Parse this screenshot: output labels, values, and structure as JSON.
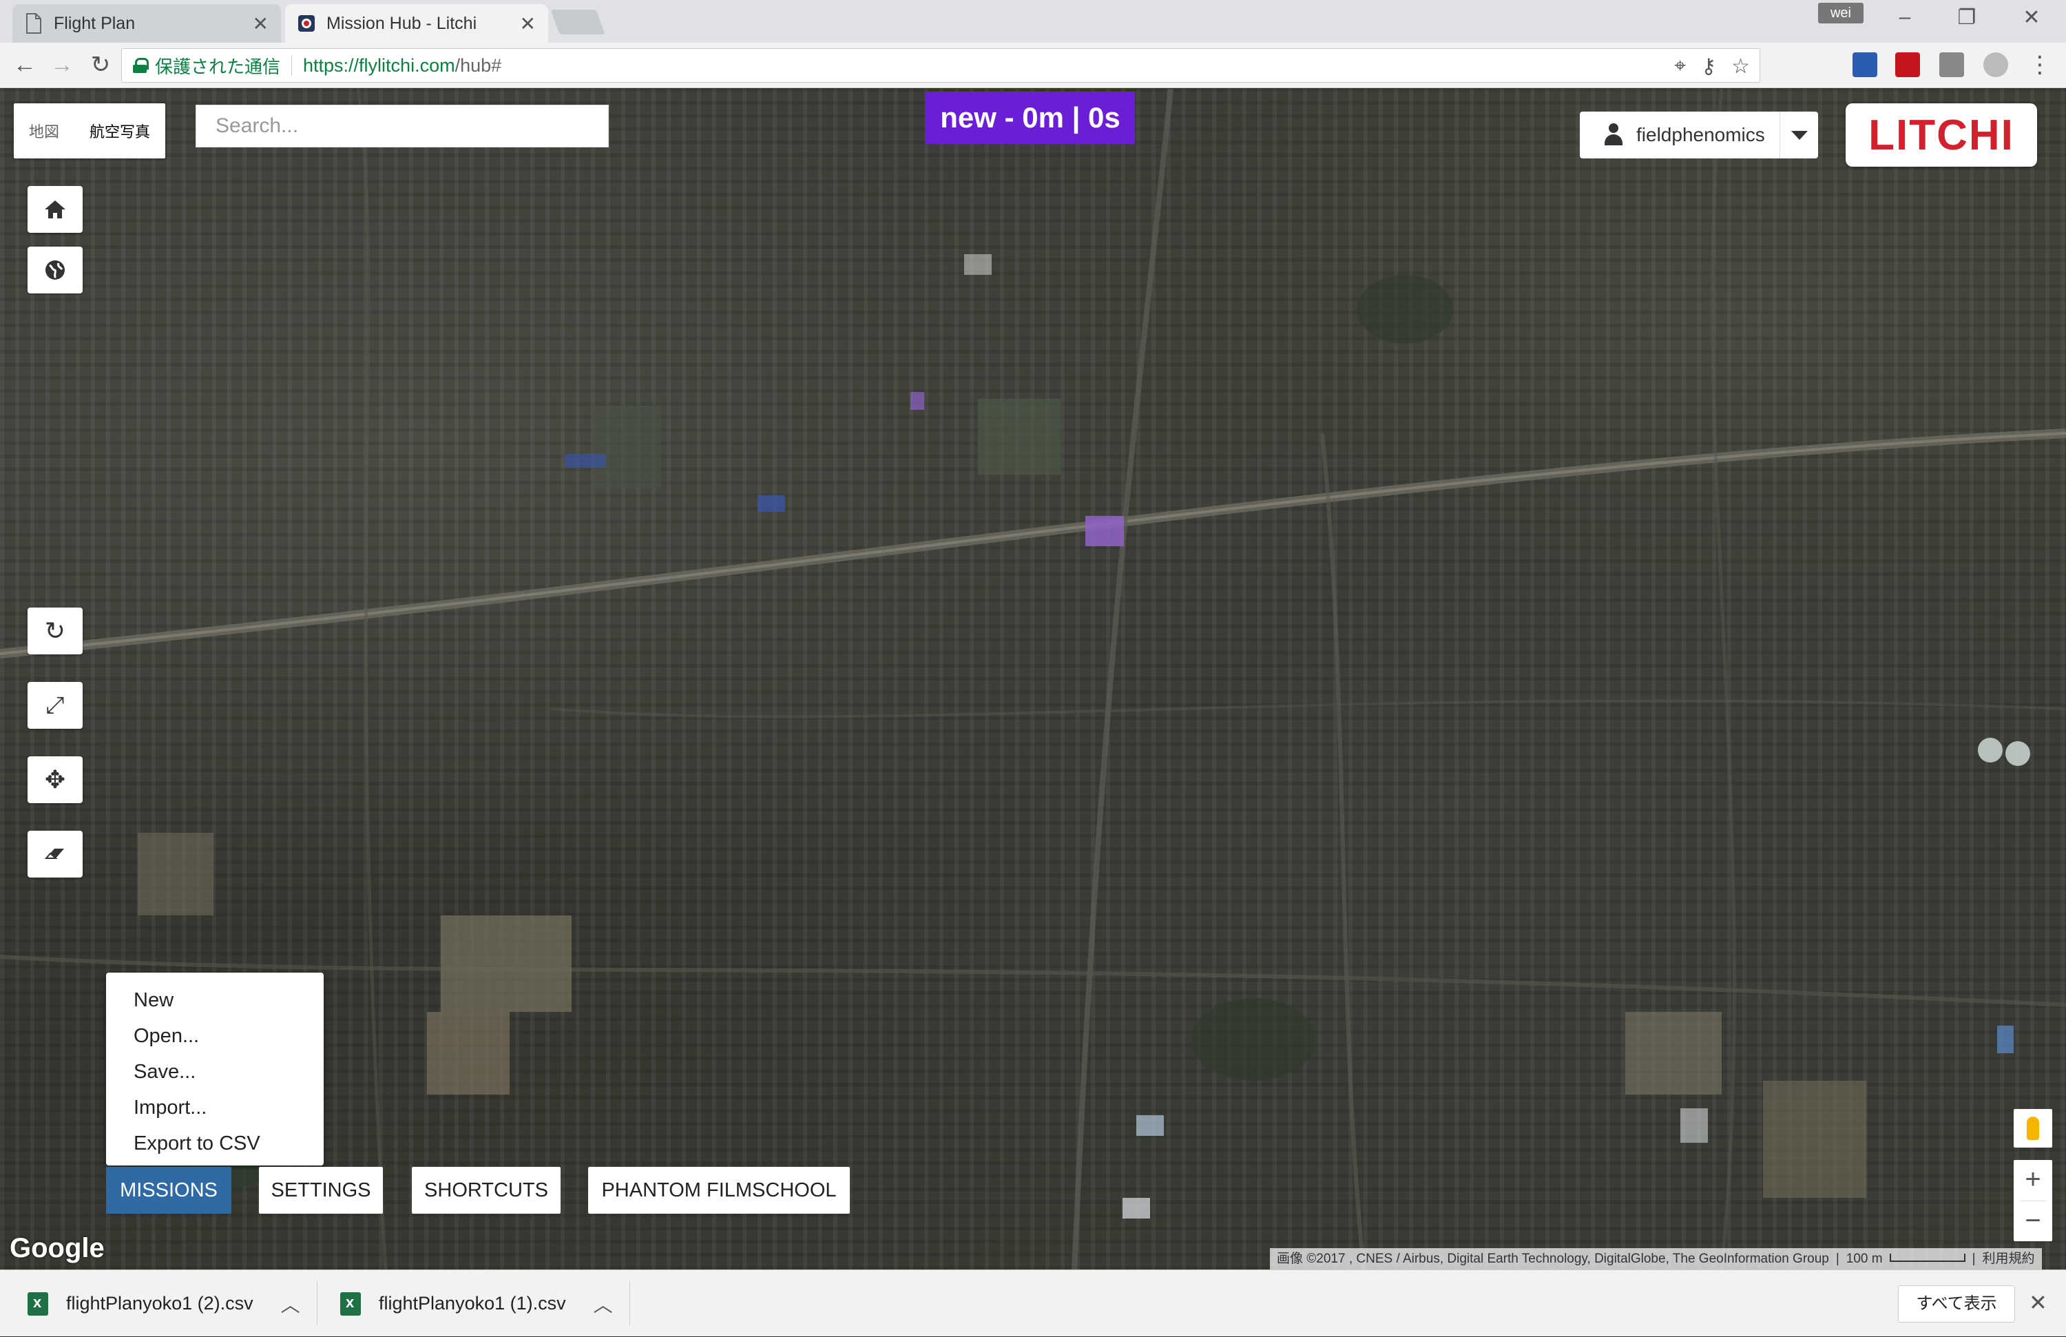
{
  "browser": {
    "tabs": [
      {
        "label": "Flight Plan",
        "active": false
      },
      {
        "label": "Mission Hub - Litchi",
        "active": true
      }
    ],
    "user_badge": "wei",
    "secure_label": "保護された通信",
    "url_host": "https://flylitchi.com",
    "url_path": "/hub#"
  },
  "map": {
    "map_type": {
      "map": "地図",
      "satellite": "航空写真"
    },
    "search_placeholder": "Search...",
    "mission_title": "new - 0m | 0s",
    "user_name": "fieldphenomics",
    "logo_text": "LITCHI",
    "google_logo": "Google",
    "attribution": "画像 ©2017 , CNES / Airbus, Digital Earth Technology, DigitalGlobe, The GeoInformation Group",
    "scale": "100 m",
    "terms": "利用規約"
  },
  "missions_menu": [
    "New",
    "Open...",
    "Save...",
    "Import...",
    "Export to CSV"
  ],
  "bottom_tabs": [
    {
      "label": "MISSIONS",
      "active": true
    },
    {
      "label": "SETTINGS",
      "active": false
    },
    {
      "label": "SHORTCUTS",
      "active": false
    },
    {
      "label": "PHANTOM FILMSCHOOL",
      "active": false
    }
  ],
  "downloads": {
    "items": [
      "flightPlanyoko1 (2).csv",
      "flightPlanyoko1 (1).csv"
    ],
    "show_all": "すべて表示"
  },
  "colors": {
    "mission_title_bg": "#6a1fd6",
    "active_tab_bg": "#2f6aa5",
    "litchi_red": "#d1212d",
    "secure_green": "#0b8043"
  }
}
